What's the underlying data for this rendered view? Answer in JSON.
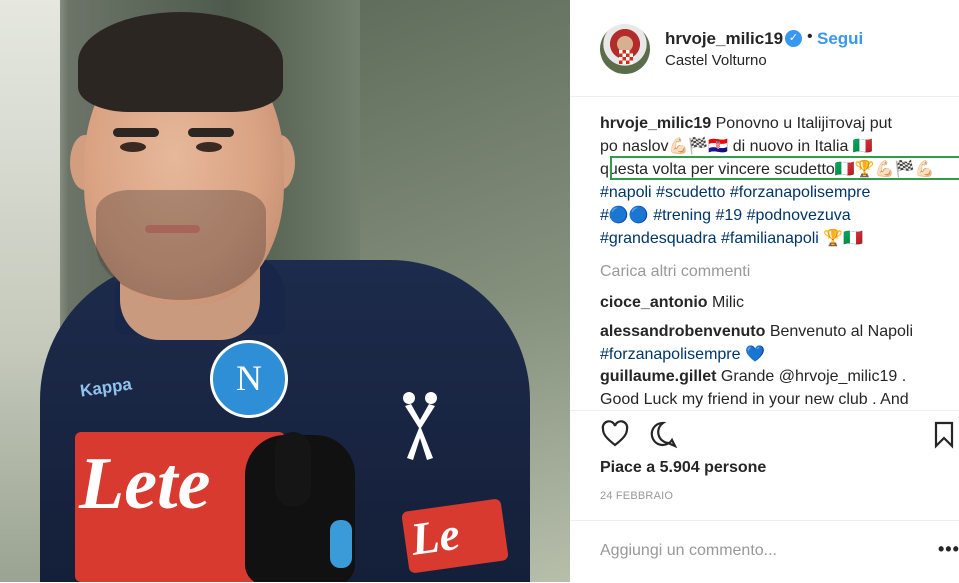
{
  "post": {
    "username": "hrvoje_milic19",
    "follow_label": "Segui",
    "location": "Castel Volturno",
    "caption": {
      "user": "hrvoje_milic19",
      "line1": "Ponovno u Italijiтovaj put",
      "line2": "po naslov💪🏻🏁🇭🇷 di nuovo in Italia 🇮🇹",
      "line3": "questa volta per vincere scudetto🇮🇹🏆💪🏻🏁💪🏻",
      "line4": "#napoli #scudetto #forzanapolisempre",
      "line5_emoji": "#🔵🔵",
      "line5_tags": "#trening #19 #podnovezuva",
      "line6": "#grandesquadra #familianapoli 🏆🇮🇹"
    },
    "load_more": "Carica altri commenti",
    "comments": [
      {
        "user": "cioce_antonio",
        "text": "Milic"
      },
      {
        "user": "alessandrobenvenuto",
        "text": "Benvenuto al Napoli",
        "tag": "#forzanapolisempre 💙"
      },
      {
        "user": "guillaume.gillet",
        "text": "Grande @hrvoje_milic19 .",
        "text2": "Good Luck my friend in your new club . And"
      }
    ],
    "likes": "Piace a 5.904 persone",
    "date": "24 FEBBRAIO",
    "add_comment_placeholder": "Aggiungi un commento...",
    "options": "•••"
  },
  "photo": {
    "badge_letter": "N",
    "kappa_text": "Kappa",
    "lete_text": "Lete",
    "lete_text_small": "Le"
  },
  "icons": {
    "like": "heart-icon",
    "comment": "comment-icon",
    "save": "bookmark-icon",
    "verified": "verified-badge-icon"
  },
  "colors": {
    "link": "#003569",
    "follow": "#3897f0",
    "highlight": "#2f9e4c"
  }
}
